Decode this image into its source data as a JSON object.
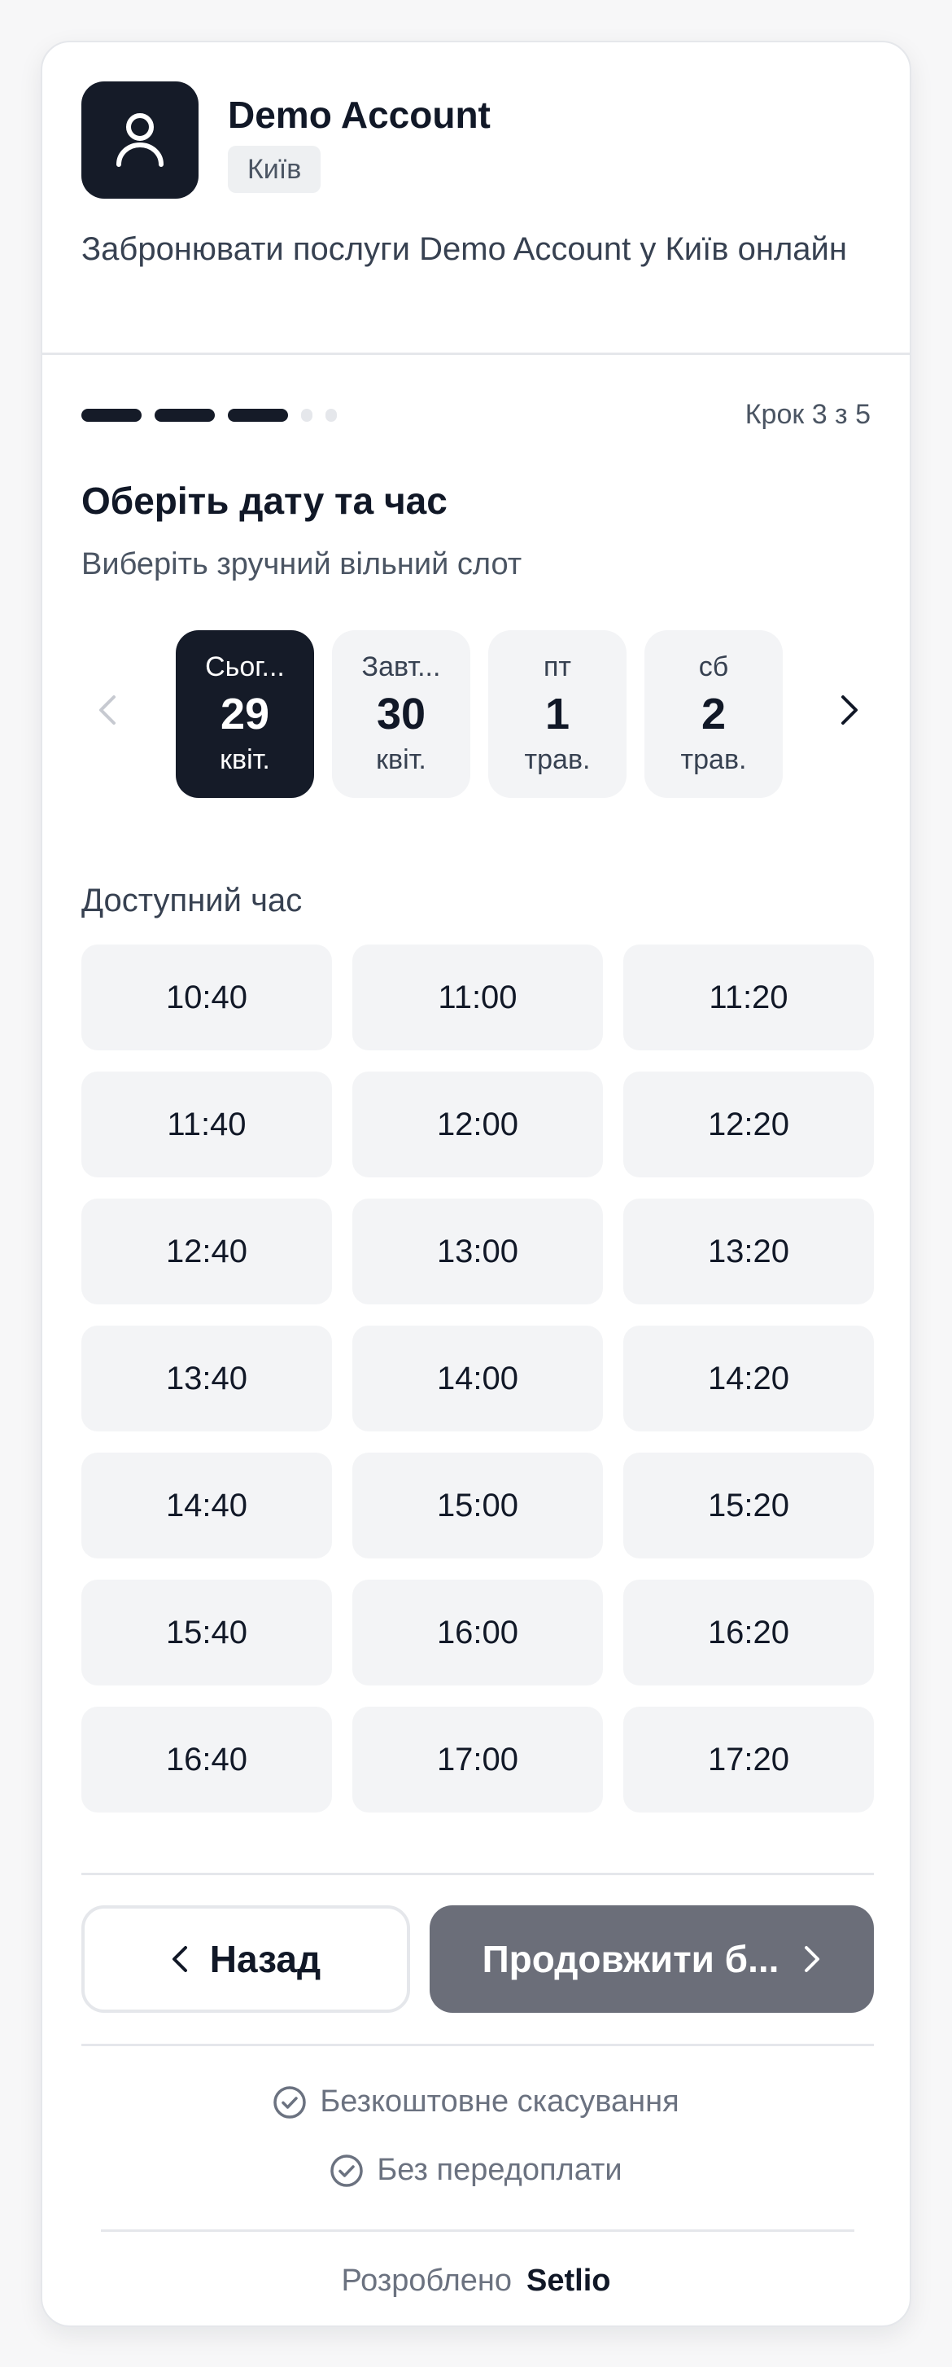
{
  "business": {
    "name": "Demo Account",
    "city": "Київ",
    "tagline": "Забронювати послуги Demo Account у Київ онлайн"
  },
  "progress": {
    "step_label": "Крок 3 з 5",
    "current": 3,
    "total": 5
  },
  "step": {
    "title": "Оберіть дату та час",
    "subtitle": "Виберіть зручний вільний слот"
  },
  "dates": [
    {
      "dow": "Сьог...",
      "day": "29",
      "month": "квіт.",
      "selected": true
    },
    {
      "dow": "Завт...",
      "day": "30",
      "month": "квіт.",
      "selected": false
    },
    {
      "dow": "пт",
      "day": "1",
      "month": "трав.",
      "selected": false
    },
    {
      "dow": "сб",
      "day": "2",
      "month": "трав.",
      "selected": false
    }
  ],
  "slots_label": "Доступний час",
  "slots": [
    "10:40",
    "11:00",
    "11:20",
    "11:40",
    "12:00",
    "12:20",
    "12:40",
    "13:00",
    "13:20",
    "13:40",
    "14:00",
    "14:20",
    "14:40",
    "15:00",
    "15:20",
    "15:40",
    "16:00",
    "16:20",
    "16:40",
    "17:00",
    "17:20"
  ],
  "actions": {
    "back_label": "Назад",
    "next_label": "Продовжити б..."
  },
  "features": [
    {
      "icon": "check-circle-icon",
      "label": "Безкоштовне скасування"
    },
    {
      "icon": "check-circle-icon",
      "label": "Без передоплати"
    }
  ],
  "footer": {
    "prefix": "Розроблено",
    "brand": "Setlio"
  },
  "colors": {
    "primary": "#151b28",
    "disabled_button": "#6b6e79",
    "chip_bg": "#f3f4f6"
  }
}
